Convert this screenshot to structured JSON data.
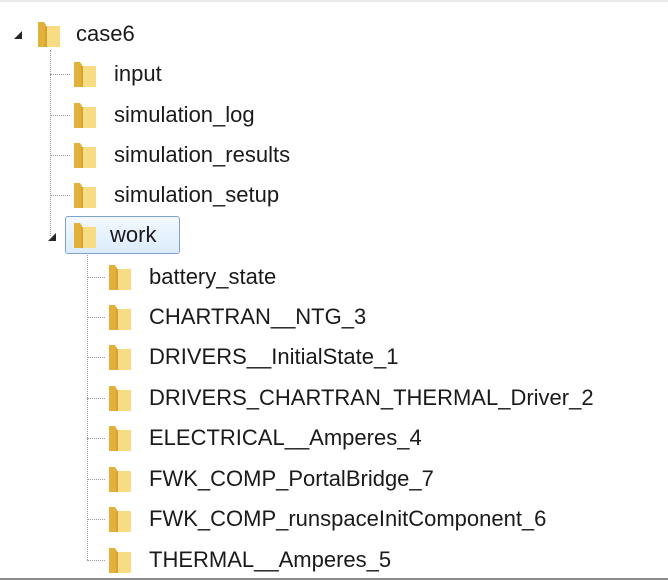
{
  "tree": {
    "root": {
      "label": "case6",
      "icon": "folder-icon",
      "expanded": true
    },
    "children": [
      {
        "label": "input",
        "icon": "folder-icon"
      },
      {
        "label": "simulation_log",
        "icon": "folder-icon"
      },
      {
        "label": "simulation_results",
        "icon": "folder-icon"
      },
      {
        "label": "simulation_setup",
        "icon": "folder-icon"
      },
      {
        "label": "work",
        "icon": "folder-icon",
        "expanded": true,
        "selected": true
      }
    ],
    "work_children": [
      {
        "label": "battery_state"
      },
      {
        "label": "CHARTRAN__NTG_3"
      },
      {
        "label": "DRIVERS__InitialState_1"
      },
      {
        "label": "DRIVERS_CHARTRAN_THERMAL_Driver_2"
      },
      {
        "label": "ELECTRICAL__Amperes_4"
      },
      {
        "label": "FWK_COMP_PortalBridge_7"
      },
      {
        "label": "FWK_COMP_runspaceInitComponent_6"
      },
      {
        "label": "THERMAL__Amperes_5"
      }
    ]
  },
  "colors": {
    "folder_light": "#f8dc84",
    "folder_dark": "#e2b13c",
    "selection_border": "#7da2ce",
    "tree_line": "#9a9a9a"
  }
}
